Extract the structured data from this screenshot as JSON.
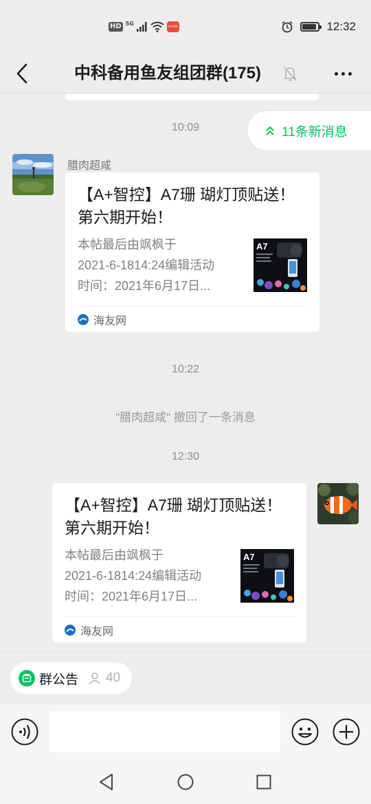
{
  "status_bar": {
    "hd": "HD",
    "network": "5G",
    "time": "12:32",
    "app_badge": "ALARM",
    "battery_level": 0.9
  },
  "header": {
    "title": "中科备用鱼友组团群(175)",
    "back_icon": "chevron-left-icon",
    "mute_icon": "bell-off-icon",
    "more_icon": "more-horizontal-icon"
  },
  "chat": {
    "times": [
      "10:09",
      "10:22",
      "12:30"
    ],
    "new_messages_label": "11条新消息",
    "recall_notice": "\"腊肉超咸\" 撤回了一条消息",
    "messages": [
      {
        "sender": "腊肉超咸",
        "title": "【A+智控】A7珊 瑚灯顶贴送！第六期开始！",
        "desc": "本帖最后由飒枫于\n2021-6-1814:24编辑活动\n时间：2021年6月17日...",
        "thumb_label": "A7",
        "source": "海友网"
      },
      {
        "sender": "",
        "title": "【A+智控】A7珊 瑚灯顶贴送！第六期开始！",
        "desc": "本帖最后由飒枫于\n2021-6-1814:24编辑活动\n时间：2021年6月17日...",
        "thumb_label": "A7",
        "source": "海友网"
      }
    ]
  },
  "notice": {
    "label": "群公告",
    "count": "40"
  },
  "input": {
    "value": "",
    "placeholder": ""
  },
  "colors": {
    "accent": "#07c160",
    "background": "#ededed",
    "card": "#ffffff"
  }
}
